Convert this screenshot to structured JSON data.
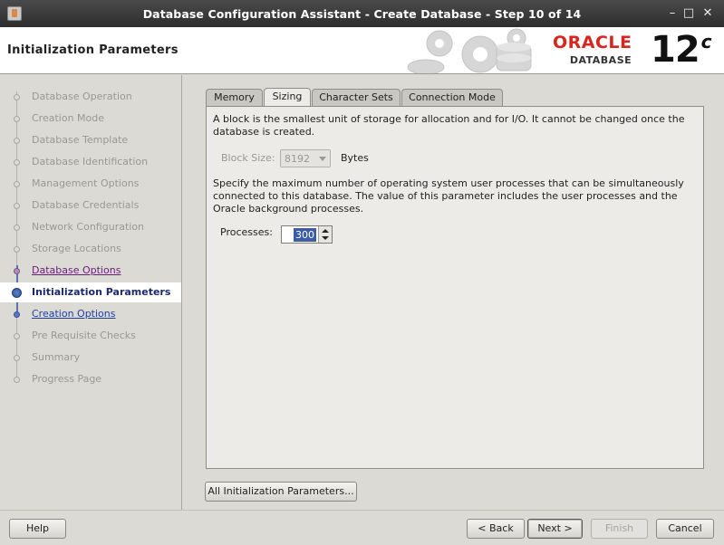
{
  "window": {
    "title": "Database Configuration Assistant - Create Database - Step 10 of 14",
    "minimize": "–",
    "maximize": "□",
    "close": "✕"
  },
  "header": {
    "page_title": "Initialization Parameters",
    "brand": "ORACLE",
    "product": "DATABASE",
    "version": "12",
    "version_suffix": "c"
  },
  "nav": {
    "items": [
      {
        "label": "Database Operation",
        "state": "disabled"
      },
      {
        "label": "Creation Mode",
        "state": "disabled"
      },
      {
        "label": "Database Template",
        "state": "disabled"
      },
      {
        "label": "Database Identification",
        "state": "disabled"
      },
      {
        "label": "Management Options",
        "state": "disabled"
      },
      {
        "label": "Database Credentials",
        "state": "disabled"
      },
      {
        "label": "Network Configuration",
        "state": "disabled"
      },
      {
        "label": "Storage Locations",
        "state": "disabled"
      },
      {
        "label": "Database Options",
        "state": "done"
      },
      {
        "label": "Initialization Parameters",
        "state": "current"
      },
      {
        "label": "Creation Options",
        "state": "next"
      },
      {
        "label": "Pre Requisite Checks",
        "state": "disabled"
      },
      {
        "label": "Summary",
        "state": "disabled"
      },
      {
        "label": "Progress Page",
        "state": "disabled"
      }
    ]
  },
  "tabs": [
    {
      "label": "Memory"
    },
    {
      "label": "Sizing",
      "active": true
    },
    {
      "label": "Character Sets"
    },
    {
      "label": "Connection Mode"
    }
  ],
  "sizing": {
    "block_description": "A block is the smallest unit of storage for allocation and for I/O. It cannot be changed once the database is created.",
    "block_size_label": "Block Size:",
    "block_size_value": "8192",
    "block_size_unit": "Bytes",
    "processes_description": "Specify the maximum number of operating system user processes that can be simultaneously connected to this database. The value of this parameter includes the user processes and the Oracle background processes.",
    "processes_label": "Processes:",
    "processes_value": "300"
  },
  "buttons": {
    "all_params": "All Initialization Parameters...",
    "help": "Help",
    "back": "< Back",
    "next": "Next >",
    "finish": "Finish",
    "cancel": "Cancel"
  }
}
